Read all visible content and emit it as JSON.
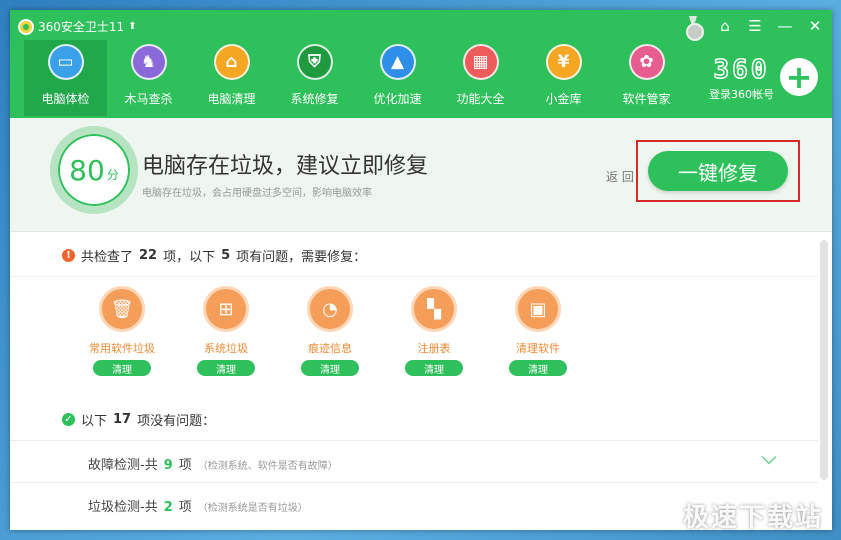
{
  "app": {
    "title": "360安全卫士11"
  },
  "window_controls": [
    "medal-icon",
    "skin-icon",
    "menu-icon",
    "minimize-icon",
    "close-icon"
  ],
  "toolbar": {
    "items": [
      {
        "label": "电脑体检",
        "icon": "monitor-icon",
        "glyph": "▭",
        "color": "#3aa0e8",
        "active": true
      },
      {
        "label": "木马查杀",
        "icon": "horse-icon",
        "glyph": "♞",
        "color": "#8a6ad8"
      },
      {
        "label": "电脑清理",
        "icon": "broom-icon",
        "glyph": "⌂",
        "color": "#f5a623"
      },
      {
        "label": "系统修复",
        "icon": "shield-icon",
        "glyph": "⛨",
        "color": "#1f9a3e"
      },
      {
        "label": "优化加速",
        "icon": "rocket-icon",
        "glyph": "▲",
        "color": "#2f8ee8"
      },
      {
        "label": "功能大全",
        "icon": "grid-icon",
        "glyph": "▦",
        "color": "#ee5b5b"
      },
      {
        "label": "小金库",
        "icon": "money-bag-icon",
        "glyph": "¥",
        "color": "#f5a623"
      },
      {
        "label": "软件管家",
        "icon": "apps-icon",
        "glyph": "✿",
        "color": "#e85d8f"
      }
    ]
  },
  "brand": {
    "number": "360",
    "login_label": "登录360帐号"
  },
  "status": {
    "score": "80",
    "score_unit": "分",
    "headline": "电脑存在垃圾，建议立即修复",
    "subtext": "电脑存在垃圾，会占用硬盘过多空间，影响电脑效率",
    "back_label": "返 回",
    "fix_button": "一键修复"
  },
  "summary": {
    "prefix": "共检查了",
    "checked": "22",
    "mid": "项，以下",
    "problems": "5",
    "suffix": "项有问题，需要修复："
  },
  "issues": [
    {
      "name": "常用软件垃圾",
      "icon": "trash-icon",
      "glyph": "🗑",
      "action": "清理"
    },
    {
      "name": "系统垃圾",
      "icon": "windows-icon",
      "glyph": "⊞",
      "action": "清理"
    },
    {
      "name": "痕迹信息",
      "icon": "clock-icon",
      "glyph": "◔",
      "action": "清理"
    },
    {
      "name": "注册表",
      "icon": "registry-icon",
      "glyph": "▚",
      "action": "清理"
    },
    {
      "name": "清理软件",
      "icon": "box-icon",
      "glyph": "▣",
      "action": "清理"
    }
  ],
  "ok_summary": {
    "prefix": "以下",
    "count": "17",
    "suffix": "项没有问题："
  },
  "categories": [
    {
      "title": "故障检测-共",
      "count": "9",
      "unit": "项",
      "desc": "（检测系统、软件是否有故障）"
    },
    {
      "title": "垃圾检测-共",
      "count": "2",
      "unit": "项",
      "desc": "（检测系统是否有垃圾）"
    }
  ],
  "watermark": "极速下载站",
  "colors": {
    "brand_green": "#2ec05a",
    "warn_orange": "#f0642d",
    "highlight_red": "#d62a2a"
  }
}
